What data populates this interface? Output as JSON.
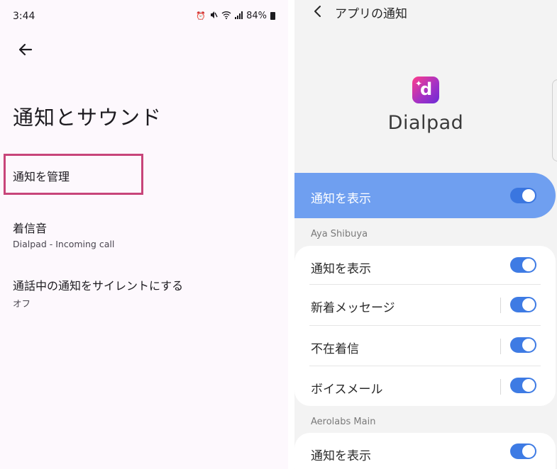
{
  "left": {
    "status": {
      "time": "3:44",
      "battery": "84%",
      "icons": [
        "alarm-icon",
        "mute-icon",
        "wifi-icon",
        "signal-icon",
        "battery-icon"
      ]
    },
    "title": "通知とサウンド",
    "items": [
      {
        "title": "通知を管理",
        "subtitle": ""
      },
      {
        "title": "着信音",
        "subtitle": "Dialpad - Incoming call"
      },
      {
        "title": "通話中の通知をサイレントにする",
        "subtitle": "オフ"
      }
    ],
    "highlight_color": "#c8457a"
  },
  "right": {
    "header_title": "アプリの通知",
    "app_name": "Dialpad",
    "master": {
      "label": "通知を表示",
      "on": true
    },
    "sections": [
      {
        "label": "Aya Shibuya",
        "rows": [
          {
            "label": "通知を表示",
            "on": true
          },
          {
            "label": "新着メッセージ",
            "on": true
          },
          {
            "label": "不在着信",
            "on": true
          },
          {
            "label": "ボイスメール",
            "on": true
          }
        ]
      },
      {
        "label": "Aerolabs Main",
        "rows": [
          {
            "label": "通知を表示",
            "on": true
          }
        ]
      }
    ],
    "accent": "#3e7be4",
    "master_bg": "#6f9ff0"
  }
}
